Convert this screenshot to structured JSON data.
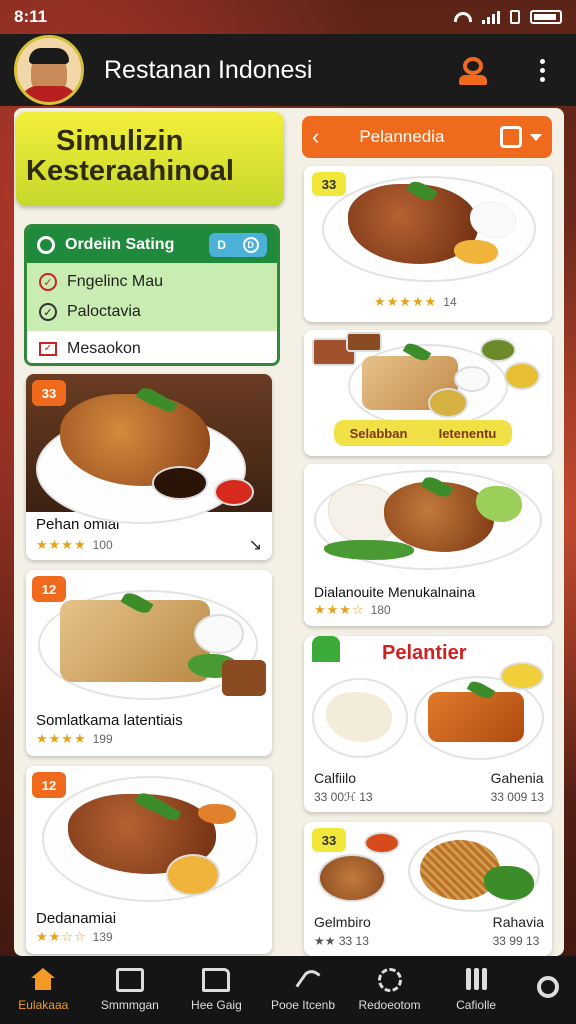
{
  "status_bar": {
    "time": "8:11"
  },
  "header": {
    "title": "Restanan Indonesi"
  },
  "promo": {
    "line1": "Simulizin",
    "line2": "Kesteraahinoal"
  },
  "order_settings": {
    "title": "Ordeiin Sating",
    "pill_left": "D",
    "pill_right": "D",
    "items": [
      "Fngelinc Mau",
      "Paloctavia"
    ],
    "last_item": "Mesaokon"
  },
  "category": {
    "label": "Pelannedia"
  },
  "left_cards": [
    {
      "badge": "33",
      "name": "Pehan omiai",
      "rating": "100",
      "stars": "★★★★",
      "extra": "↘"
    },
    {
      "badge": "12",
      "name": "Somlatkama latentiais",
      "rating": "199",
      "stars": "★★★★"
    },
    {
      "badge": "12",
      "name": "Dedanamiai",
      "rating": "139",
      "stars": "★★☆☆"
    }
  ],
  "right_cards": [
    {
      "badge": "33",
      "stars": "★★★★★",
      "rating": "14"
    },
    {
      "label_left": "Selabban",
      "label_right": "Ietenentu"
    },
    {
      "name": "Dialanouite Menukalnaina",
      "rating": "180",
      "stars": "★★★☆"
    },
    {
      "heading": "Pelantier",
      "cap_left": "Calfiilo",
      "cap_right": "Gahenia",
      "sub_left": "33 00ℋ 13",
      "sub_right": "33 009 13"
    },
    {
      "badge": "33",
      "cap_left": "Gelmbiro",
      "cap_right": "Rahavia",
      "sub_left": "★★ 33 13",
      "sub_right": "33 99 13"
    }
  ],
  "nav": {
    "items": [
      "Eulakaaa",
      "Smmmgan",
      "Hee Gaig",
      "Pooe Itcenb",
      "Redoeotom",
      "Cafiolle"
    ]
  },
  "colors": {
    "accent_orange": "#f06a1e",
    "green": "#1f8a3c",
    "yellow": "#f1e63a",
    "nav_active": "#f29a24"
  }
}
